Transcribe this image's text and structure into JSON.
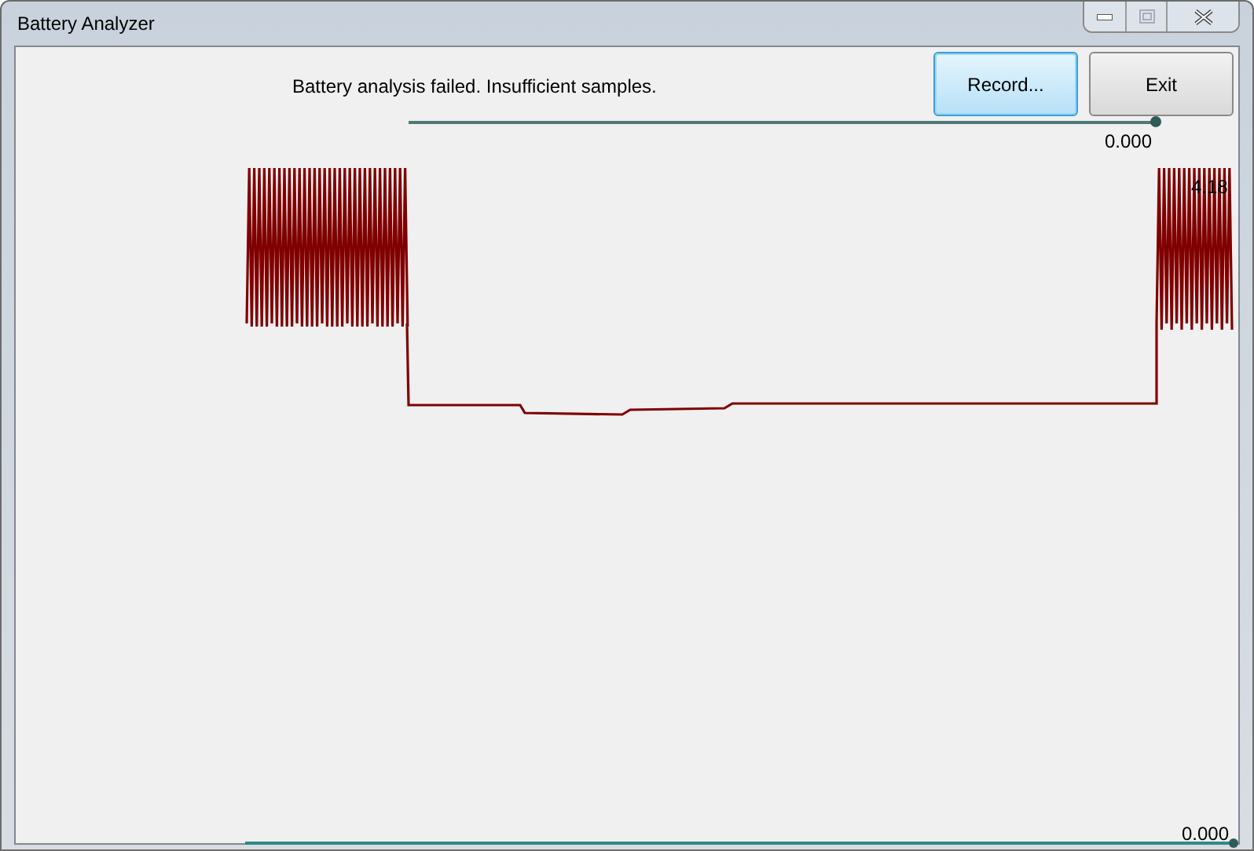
{
  "window": {
    "title": "Battery Analyzer"
  },
  "status_message": "Battery analysis failed. Insufficient samples.",
  "buttons": [
    {
      "label": "Record...",
      "selected": true
    },
    {
      "label": "Exit",
      "selected": false
    }
  ],
  "top_slider": {
    "level": 1,
    "reading": "0.000"
  },
  "plot": {
    "max_label": "4.18"
  },
  "bottom_slider": {
    "level": 1,
    "reading": "0.000"
  }
}
